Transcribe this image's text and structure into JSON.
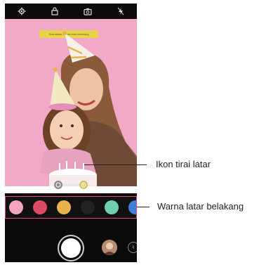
{
  "status_bar": {
    "icons": [
      "gear-icon",
      "lock-icon",
      "camera-switch-icon",
      "flash-off-icon"
    ]
  },
  "viewfinder": {
    "banner_text": "Sesuaikan warna latar belakang",
    "background_color": "#f2a9c8",
    "curtain_buttons": [
      "curtain-off-icon",
      "curtain-on-icon"
    ]
  },
  "palette": {
    "swatches": [
      "#f3a6bf",
      "#dc4a62",
      "#e7b34a",
      "#222222",
      "#6fd0b0",
      "#3f7ed8"
    ],
    "border_color": "#d94b7b"
  },
  "controls": {
    "shutter_icon": "shutter-icon",
    "gallery_icon": "gallery-thumbnail",
    "collapse_icon": "chevron-left-icon"
  },
  "callouts": {
    "curtain_label": "Ikon tirai latar",
    "palette_label": "Warna latar belakang"
  }
}
